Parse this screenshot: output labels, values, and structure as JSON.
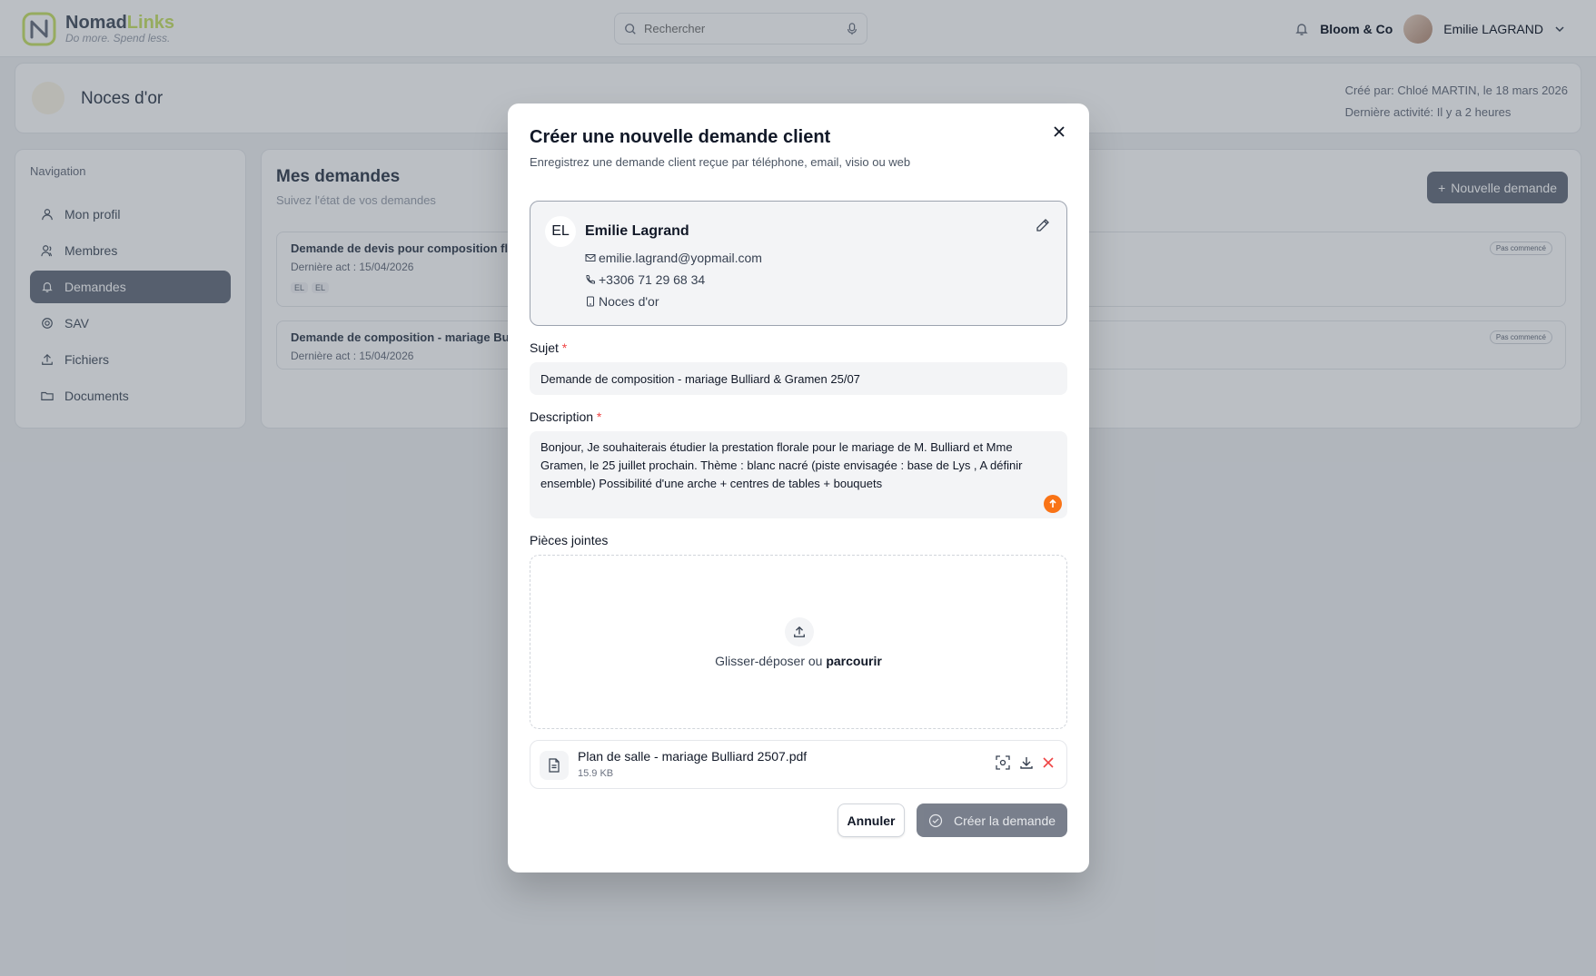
{
  "header": {
    "brand_part1": "Nomad",
    "brand_part2": "Links",
    "tagline": "Do more. Spend less.",
    "search_placeholder": "Rechercher",
    "organization": "Bloom & Co",
    "user_name": "Emilie LAGRAND"
  },
  "project": {
    "title": "Noces d'or",
    "created_by": "Créé par: Chloé MARTIN, le 18 mars 2026",
    "last_activity": "Dernière activité: Il y a 2 heures"
  },
  "navigation": {
    "title": "Navigation",
    "items": [
      {
        "label": "Mon profil",
        "icon": "user-icon"
      },
      {
        "label": "Membres",
        "icon": "users-icon"
      },
      {
        "label": "Demandes",
        "icon": "bell-icon",
        "active": true
      },
      {
        "label": "SAV",
        "icon": "lifebuoy-icon"
      },
      {
        "label": "Fichiers",
        "icon": "upload-icon"
      },
      {
        "label": "Documents",
        "icon": "folder-icon"
      }
    ]
  },
  "requests": {
    "title": "Mes demandes",
    "subtitle": "Suivez l'état de vos demandes",
    "new_button": "Nouvelle demande",
    "items": [
      {
        "title": "Demande de devis pour composition fl",
        "date": "Dernière act : 15/04/2026",
        "badge": "Pas commencé",
        "tags": [
          "EL",
          "EL"
        ]
      },
      {
        "title": "Demande de composition - mariage Bu",
        "date": "Dernière act : 15/04/2026",
        "badge": "Pas commencé"
      }
    ]
  },
  "modal": {
    "title": "Créer une nouvelle demande client",
    "subtitle": "Enregistrez une demande client reçue par téléphone, email, visio ou web",
    "client": {
      "initials": "EL",
      "name": "Emilie Lagrand",
      "email": "emilie.lagrand@yopmail.com",
      "phone": "+3306 71 29 68 34",
      "project": "Noces d'or"
    },
    "subject_label": "Sujet",
    "subject_value": "Demande de composition - mariage Bulliard & Gramen 25/07",
    "description_label": "Description",
    "description_value": "Bonjour, Je souhaiterais étudier la prestation florale pour le mariage de M. Bulliard et Mme Gramen, le 25 juillet prochain. Thème : blanc nacré (piste envisagée : base de Lys , A définir ensemble) Possibilité d'une arche + centres de tables + bouquets",
    "attachments_label": "Pièces jointes",
    "drop_text": "Glisser-déposer ou",
    "drop_link": "parcourir",
    "file": {
      "name": "Plan de salle - mariage Bulliard 2507.pdf",
      "size": "15.9 KB"
    },
    "cancel_label": "Annuler",
    "create_label": "Créer la demande"
  },
  "colors": {
    "brand_accent": "#c9e26a",
    "danger": "#ef4444",
    "orange": "#f97316"
  }
}
